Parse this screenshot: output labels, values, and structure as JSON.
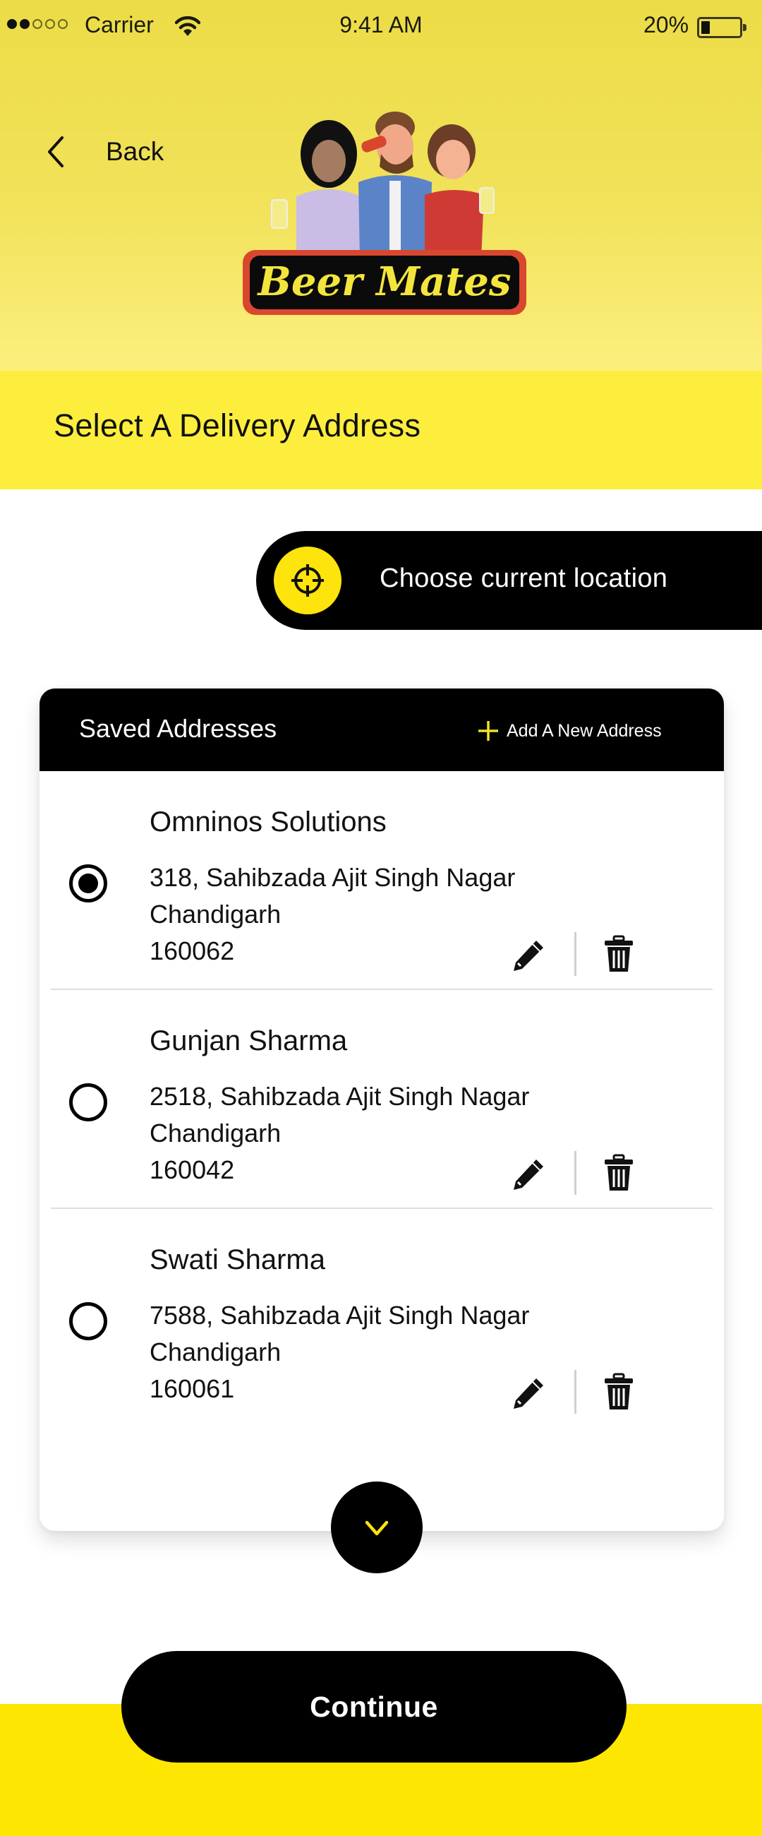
{
  "status_bar": {
    "signal_bars_filled": 2,
    "signal_bars_total": 5,
    "carrier": "Carrier",
    "wifi_icon": "wifi-icon",
    "time": "9:41 AM",
    "battery_percent_label": "20%",
    "battery_level": 0.2
  },
  "header": {
    "back_icon": "chevron-left-icon",
    "back_label": "Back",
    "logo_text": "Beer Mates"
  },
  "page": {
    "title": "Select A Delivery Address"
  },
  "current_location": {
    "icon": "crosshair-icon",
    "label": "Choose current location"
  },
  "saved_addresses": {
    "title": "Saved Addresses",
    "add_icon": "plus-icon",
    "add_label": "Add A New Address",
    "items": [
      {
        "name": "Omninos Solutions",
        "line1": "318, Sahibzada Ajit Singh Nagar",
        "line2": "Chandigarh",
        "line3": "160062",
        "selected": true
      },
      {
        "name": "Gunjan Sharma",
        "line1": "2518, Sahibzada Ajit Singh Nagar",
        "line2": "Chandigarh",
        "line3": "160042",
        "selected": false
      },
      {
        "name": "Swati Sharma",
        "line1": "7588, Sahibzada Ajit Singh Nagar",
        "line2": "Chandigarh",
        "line3": "160061",
        "selected": false
      }
    ],
    "edit_icon": "pencil-icon",
    "delete_icon": "trash-icon",
    "expand_icon": "chevron-down-icon"
  },
  "footer": {
    "continue_label": "Continue"
  },
  "colors": {
    "brand_yellow": "#fde602",
    "title_band": "#fdee3e",
    "header_top": "#ecdc47",
    "header_bottom": "#fcef7e",
    "black": "#000000",
    "logo_text": "#f3e53c",
    "logo_border": "#d9472f"
  }
}
